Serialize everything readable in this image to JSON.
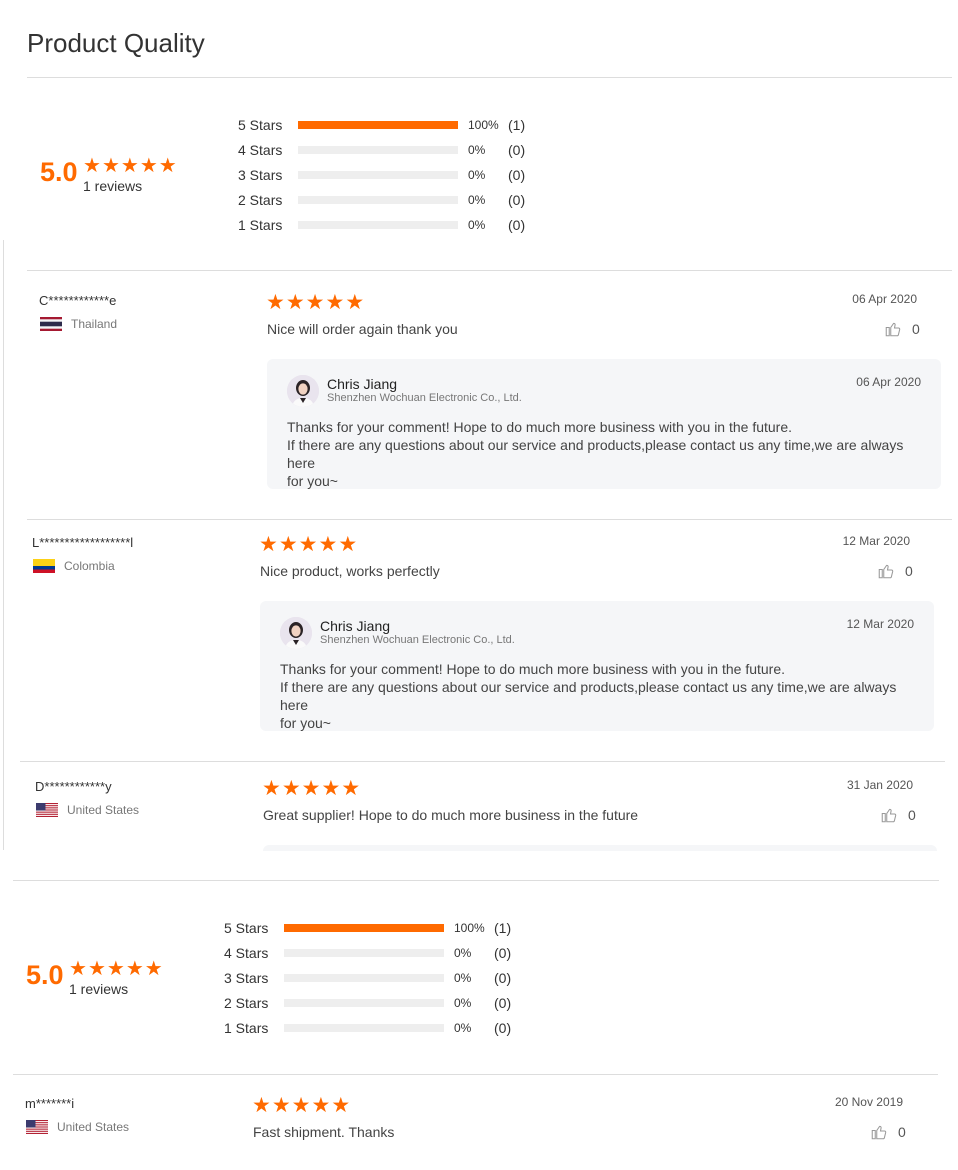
{
  "page_title": "Product Quality",
  "summary": {
    "score": "5.0",
    "reviews_label": "1 reviews",
    "rows": [
      {
        "label": "5  Stars",
        "fraction": 1.0,
        "pct": "100%",
        "count": "(1)"
      },
      {
        "label": "4  Stars",
        "fraction": 0.0,
        "pct": "0%",
        "count": "(0)"
      },
      {
        "label": "3  Stars",
        "fraction": 0.0,
        "pct": "0%",
        "count": "(0)"
      },
      {
        "label": "2  Stars",
        "fraction": 0.0,
        "pct": "0%",
        "count": "(0)"
      },
      {
        "label": "1  Stars",
        "fraction": 0.0,
        "pct": "0%",
        "count": "(0)"
      }
    ]
  },
  "reviews": [
    {
      "reviewer": "C************e",
      "country": "Thailand",
      "flag": "thailand",
      "rating": 5,
      "text": "Nice will order again thank you",
      "date": "06 Apr 2020",
      "likes": "0",
      "reply": {
        "name": "Chris Jiang",
        "company": "Shenzhen Wochuan Electronic Co., Ltd.",
        "date": "06 Apr 2020",
        "line1": "Thanks for your comment! Hope to do much more business with you in the future.",
        "line2": "If there are any questions about our service and products,please contact us any time,we are always here",
        "line3": "for you~"
      }
    },
    {
      "reviewer": "L******************l",
      "country": "Colombia",
      "flag": "colombia",
      "rating": 5,
      "text": "Nice product, works perfectly",
      "date": "12 Mar 2020",
      "likes": "0",
      "reply": {
        "name": "Chris Jiang",
        "company": "Shenzhen Wochuan Electronic Co., Ltd.",
        "date": "12 Mar 2020",
        "line1": "Thanks for your comment! Hope to do much more business with you in the future.",
        "line2": "If there are any questions about our service and products,please contact us any time,we are always here",
        "line3": "for you~"
      }
    },
    {
      "reviewer": "D************y",
      "country": "United States",
      "flag": "usa",
      "rating": 5,
      "text": "Great supplier!  Hope to do much more business in the future",
      "date": "31 Jan 2020",
      "likes": "0"
    },
    {
      "reviewer": "m*******i",
      "country": "United States",
      "flag": "usa",
      "rating": 5,
      "text": "Fast shipment.  Thanks",
      "date": "20 Nov 2019",
      "likes": "0"
    }
  ],
  "colors": {
    "accent": "#ff6a00",
    "bar_empty": "#eeeeee",
    "reply_bg": "#f5f6f8"
  },
  "icons": {
    "star": "star-icon",
    "like": "thumbs-up-icon"
  }
}
